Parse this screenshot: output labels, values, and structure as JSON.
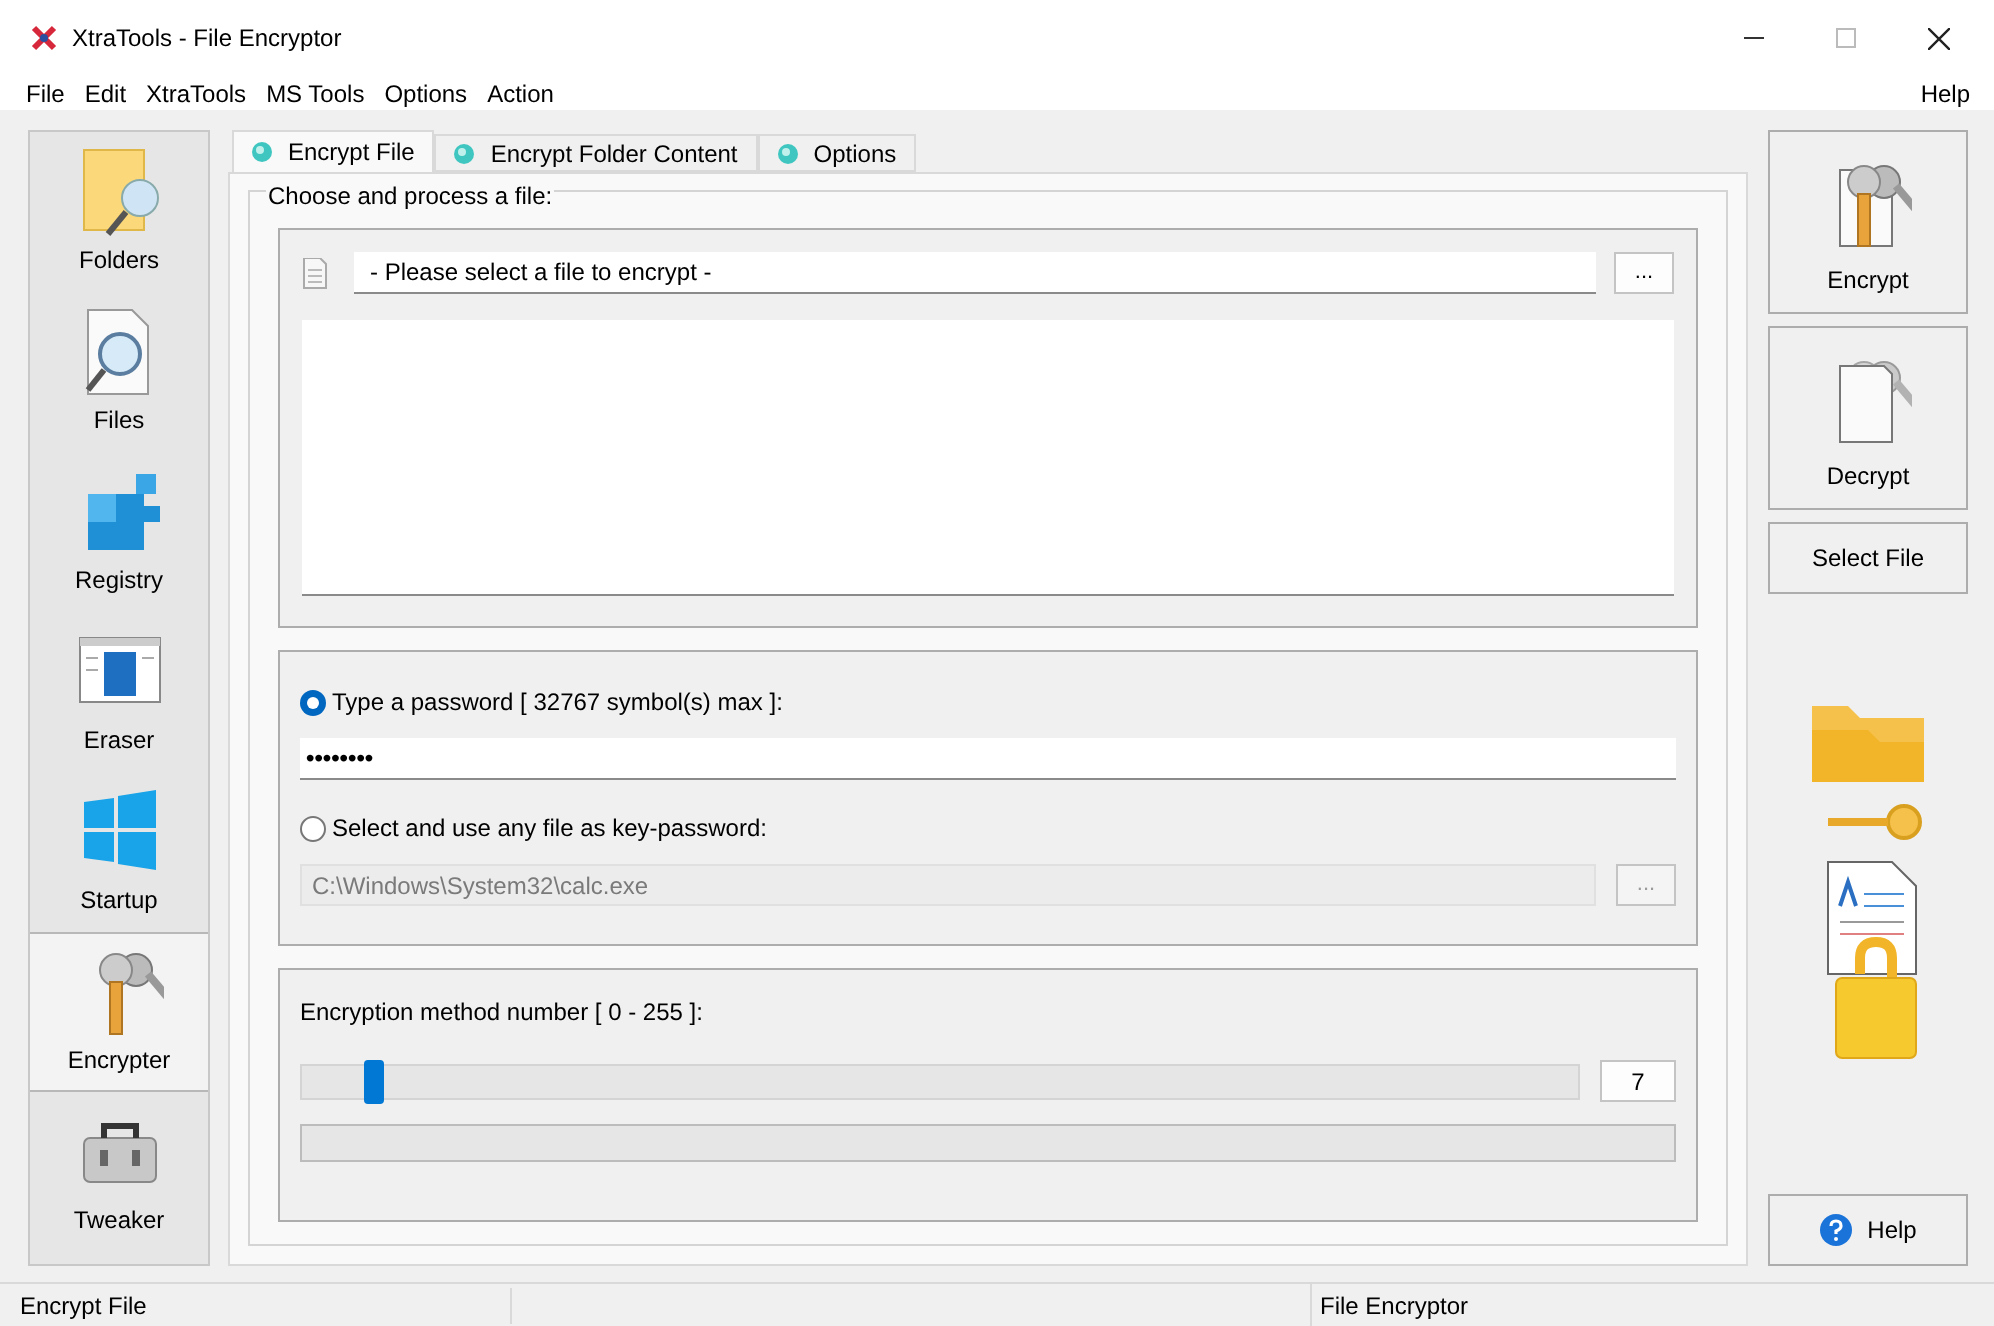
{
  "window": {
    "title": "XtraTools - File Encryptor"
  },
  "menu": [
    "File",
    "Edit",
    "XtraTools",
    "MS Tools",
    "Options",
    "Action"
  ],
  "menu_right": "Help",
  "sidebar": {
    "items": [
      {
        "label": "Folders",
        "kind": "folders",
        "selected": false
      },
      {
        "label": "Files",
        "kind": "files",
        "selected": false
      },
      {
        "label": "Registry",
        "kind": "registry",
        "selected": false
      },
      {
        "label": "Eraser",
        "kind": "eraser",
        "selected": false
      },
      {
        "label": "Startup",
        "kind": "startup",
        "selected": false
      },
      {
        "label": "Encrypter",
        "kind": "encrypter",
        "selected": true
      },
      {
        "label": "Tweaker",
        "kind": "tweaker",
        "selected": false
      }
    ]
  },
  "tabs": [
    {
      "label": "Encrypt File",
      "selected": true
    },
    {
      "label": "Encrypt Folder Content",
      "selected": false
    },
    {
      "label": "Options",
      "selected": false
    }
  ],
  "file_group": {
    "title": "Choose and process a file:",
    "file_field": {
      "value": "- Please select a file to encrypt -"
    },
    "browse_button": "..."
  },
  "password_group": {
    "options": [
      {
        "label": "Type a password [ 32767 symbol(s) max ]:",
        "selected": true
      },
      {
        "label": "Select and use any file as key-password:",
        "selected": false
      }
    ],
    "password_field": {
      "value": "••••••••"
    },
    "key_file_field": {
      "value": "C:\\Windows\\System32\\calc.exe",
      "disabled": true
    },
    "browse_button": {
      "label": "...",
      "disabled": true
    }
  },
  "method_group": {
    "label": "Encryption method number [ 0 - 255 ]:",
    "slider": {
      "level": 0.027
    },
    "value": "7",
    "progress": {
      "level": 0
    }
  },
  "actions": [
    {
      "label": "Encrypt",
      "kind": "encrypt"
    },
    {
      "label": "Decrypt",
      "kind": "decrypt"
    },
    {
      "label": "Select File",
      "kind": "plain"
    }
  ],
  "help_button": "Help",
  "status_bar": {
    "left": "Encrypt File",
    "right": "File Encryptor"
  }
}
